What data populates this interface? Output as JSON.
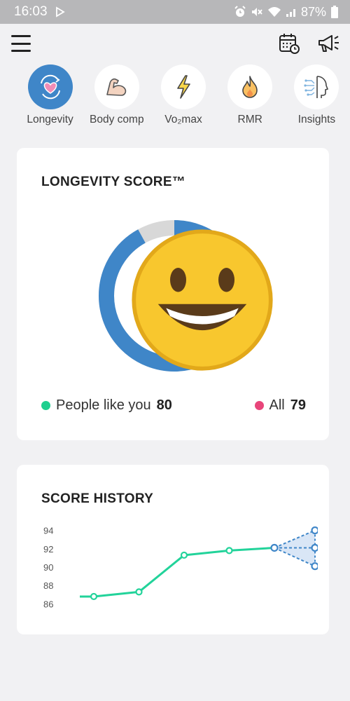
{
  "status_bar": {
    "time": "16:03",
    "battery": "87%",
    "icons": [
      "play-store-icon",
      "alarm-icon",
      "mute-icon",
      "wifi-icon",
      "signal-icon",
      "battery-icon"
    ]
  },
  "topbar": {
    "menu_icon": "hamburger-menu-icon",
    "actions": [
      "calendar-clock-icon",
      "megaphone-icon"
    ]
  },
  "tabs": [
    {
      "label": "Longevity",
      "icon": "heart-refresh-icon",
      "active": true
    },
    {
      "label": "Body comp",
      "icon": "flexed-arm-icon",
      "active": false
    },
    {
      "label": "Vo₂max",
      "icon": "lightning-icon",
      "active": false
    },
    {
      "label": "RMR",
      "icon": "flame-icon",
      "active": false
    },
    {
      "label": "Insights",
      "icon": "head-insights-icon",
      "active": false
    }
  ],
  "score_card": {
    "title": "LONGEVITY SCORE™",
    "score": "92",
    "score_fraction": 0.92,
    "emoji": "grinning-face-icon",
    "legend": [
      {
        "label": "People like you",
        "value": "80",
        "color": "#1fcf8f"
      },
      {
        "label": "All",
        "value": "79",
        "color": "#e8457a"
      }
    ],
    "colors": {
      "ring": "#3f86c8",
      "ring_track": "#d8d8d8"
    }
  },
  "history_card": {
    "title": "SCORE HISTORY"
  },
  "chart_data": {
    "type": "line",
    "title": "SCORE HISTORY",
    "xlabel": "",
    "ylabel": "",
    "yticks": [
      "94",
      "92",
      "90",
      "88",
      "86"
    ],
    "ylim": [
      85.5,
      94.5
    ],
    "grid": false,
    "series": [
      {
        "values": [
          86.8,
          86.8,
          87.3,
          91.3,
          91.8,
          92.1
        ],
        "color": "#22d39a"
      }
    ],
    "projection": {
      "start": 92.1,
      "targets": [
        94.0,
        92.1,
        90.1
      ],
      "color": "#3f86c8",
      "fill": "#cfe0f4"
    }
  }
}
